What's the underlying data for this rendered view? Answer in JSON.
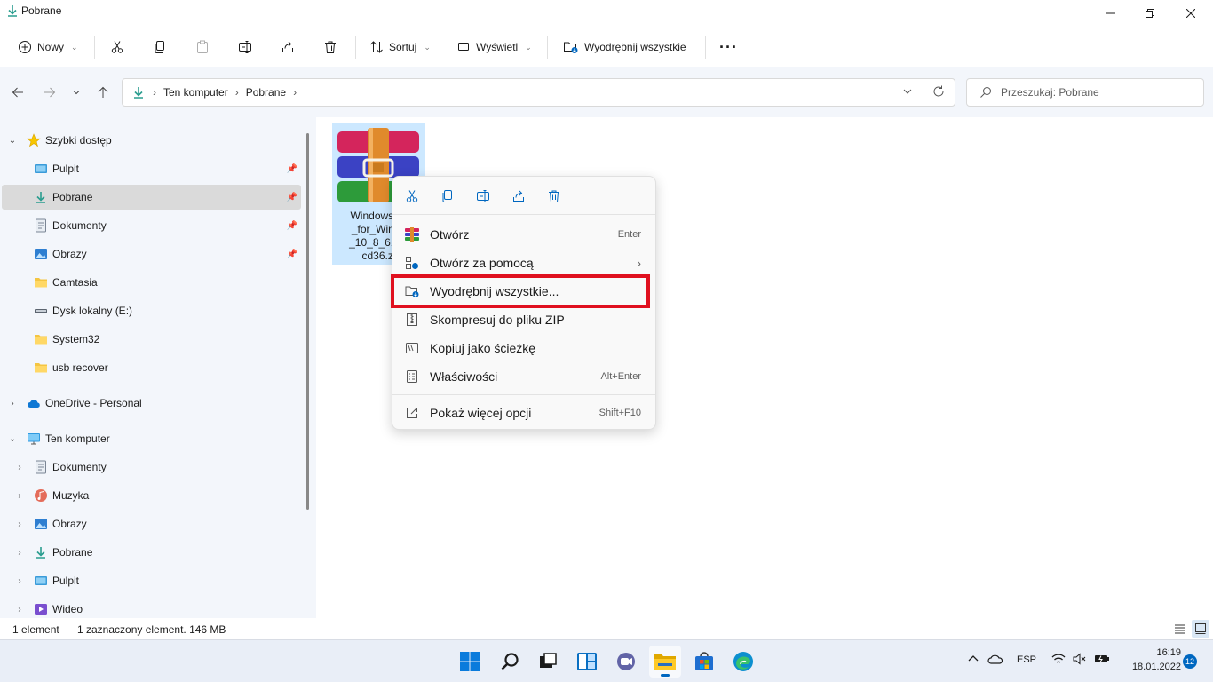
{
  "window": {
    "title": "Pobrane"
  },
  "toolbar": {
    "new_label": "Nowy",
    "sort_label": "Sortuj",
    "view_label": "Wyświetl",
    "extract_label": "Wyodrębnij wszystkie"
  },
  "address": {
    "crumbs": [
      "Ten komputer",
      "Pobrane"
    ],
    "search_placeholder": "Przeszukaj: Pobrane"
  },
  "sidebar": {
    "quick_access": "Szybki dostęp",
    "quick_items": [
      "Pulpit",
      "Pobrane",
      "Dokumenty",
      "Obrazy",
      "Camtasia",
      "Dysk lokalny (E:)",
      "System32",
      "usb recover"
    ],
    "onedrive": "OneDrive - Personal",
    "this_pc": "Ten komputer",
    "pc_items": [
      "Dokumenty",
      "Muzyka",
      "Obrazy",
      "Pobrane",
      "Pulpit",
      "Wideo"
    ]
  },
  "file": {
    "name": "Windows7C_for_Windows_10_8_61b8cd36.zip",
    "name_visible": "Windows7C\n_for_Windo\n_10_8_61b8\ncd36.zi"
  },
  "context_menu": {
    "items": [
      {
        "label": "Otwórz",
        "shortcut": "Enter"
      },
      {
        "label": "Otwórz za pomocą",
        "shortcut": ""
      },
      {
        "label": "Wyodrębnij wszystkie...",
        "shortcut": ""
      },
      {
        "label": "Skompresuj do pliku ZIP",
        "shortcut": ""
      },
      {
        "label": "Kopiuj jako ścieżkę",
        "shortcut": ""
      },
      {
        "label": "Właściwości",
        "shortcut": "Alt+Enter"
      },
      {
        "label": "Pokaż więcej opcji",
        "shortcut": "Shift+F10"
      }
    ],
    "highlight_color": "#e0101f"
  },
  "status": {
    "count": "1 element",
    "selection": "1 zaznaczony element. 146 MB"
  },
  "taskbar": {
    "language": "ESP",
    "time": "16:19",
    "date": "18.01.2022",
    "notifications": "12"
  },
  "colors": {
    "accent": "#0067c0",
    "selection": "#cce8ff",
    "sidebar_bg": "#f3f6fb"
  }
}
